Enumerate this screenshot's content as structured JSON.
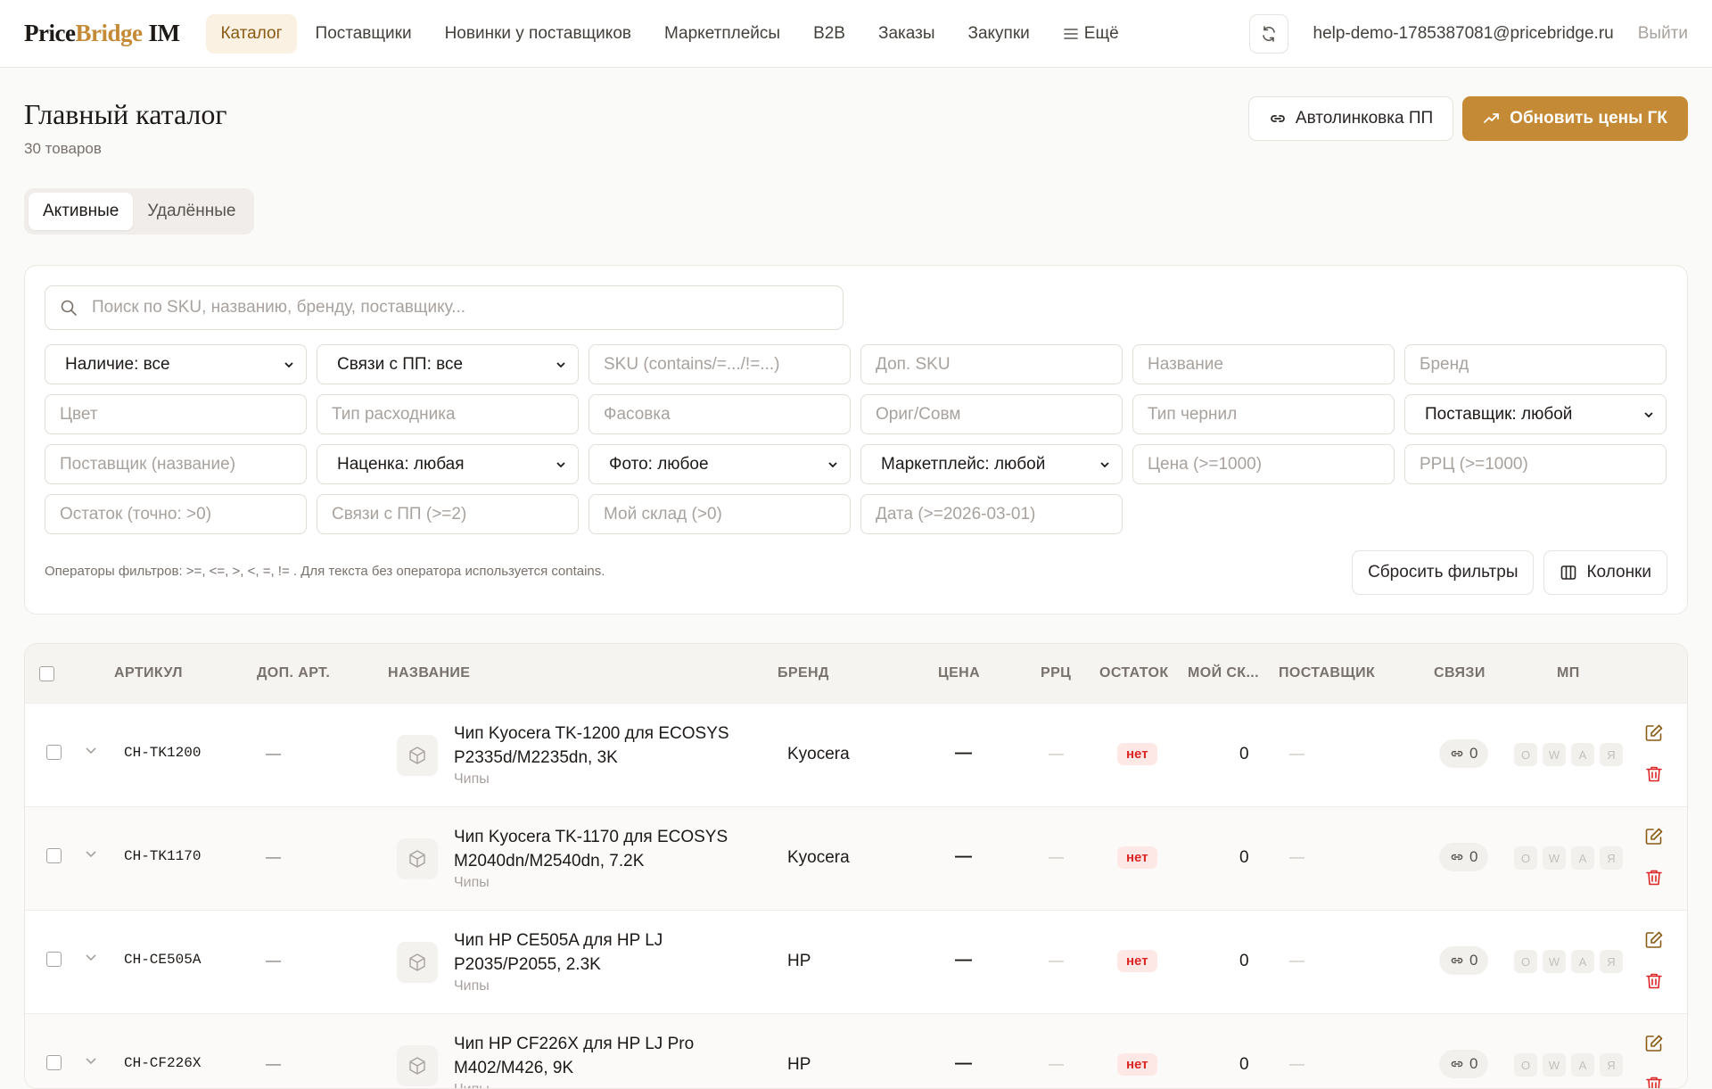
{
  "app": {
    "logo_price": "Price",
    "logo_bridge": "Bridge",
    "logo_im": "IM"
  },
  "nav": {
    "items": [
      {
        "label": "Каталог",
        "active": true
      },
      {
        "label": "Поставщики"
      },
      {
        "label": "Новинки у поставщиков"
      },
      {
        "label": "Маркетплейсы"
      },
      {
        "label": "B2B"
      },
      {
        "label": "Заказы"
      },
      {
        "label": "Закупки"
      }
    ],
    "more_label": "Ещё",
    "user_email": "help-demo-1785387081@pricebridge.ru",
    "logout_label": "Выйти"
  },
  "header": {
    "title": "Главный каталог",
    "subtitle": "30 товаров",
    "autolink_label": "Автолинковка ПП",
    "update_prices_label": "Обновить цены ГК"
  },
  "tabs": [
    {
      "label": "Активные",
      "active": true
    },
    {
      "label": "Удалённые"
    }
  ],
  "filters": {
    "search_placeholder": "Поиск по SKU, названию, бренду, поставщику...",
    "availability": "Наличие: все",
    "links": "Связи с ПП: все",
    "sku_placeholder": "SKU (contains/=.../!=...)",
    "extra_sku_placeholder": "Доп. SKU",
    "name_placeholder": "Название",
    "brand_placeholder": "Бренд",
    "color_placeholder": "Цвет",
    "consumable_placeholder": "Тип расходника",
    "pack_placeholder": "Фасовка",
    "orig_placeholder": "Ориг/Совм",
    "ink_placeholder": "Тип чернил",
    "supplier_select": "Поставщик: любой",
    "supplier_name_placeholder": "Поставщик (название)",
    "markup_select": "Наценка: любая",
    "photo_select": "Фото: любое",
    "marketplace_select": "Маркетплейс: любой",
    "price_placeholder": "Цена (>=1000)",
    "rrp_placeholder": "РРЦ (>=1000)",
    "stock_placeholder": "Остаток (точно: >0)",
    "links_count_placeholder": "Связи с ПП (>=2)",
    "my_stock_placeholder": "Мой склад (>0)",
    "date_placeholder": "Дата (>=2026-03-01)",
    "note": "Операторы фильтров: >=, <=, >, <, =, != . Для текста без оператора используется contains.",
    "reset_label": "Сбросить фильтры",
    "columns_label": "Колонки"
  },
  "table": {
    "headers": {
      "sku": "АРТИКУЛ",
      "extra_sku": "ДОП. АРТ.",
      "name": "НАЗВАНИЕ",
      "brand": "БРЕНД",
      "price": "ЦЕНА",
      "rrp": "РРЦ",
      "stock": "ОСТАТОК",
      "my_stock": "МОЙ СК...",
      "supplier": "ПОСТАВЩИК",
      "links": "СВЯЗИ",
      "mp": "МП"
    },
    "rows": [
      {
        "sku": "CH-TK1200",
        "extra": "—",
        "name": "Чип Kyocera TK-1200 для ECOSYS P2335d/M2235dn, 3K",
        "category": "Чипы",
        "brand": "Kyocera",
        "price": "—",
        "rrp": "—",
        "stock": "нет",
        "my_stock": "0",
        "supplier": "—",
        "links": "0"
      },
      {
        "sku": "CH-TK1170",
        "extra": "—",
        "name": "Чип Kyocera TK-1170 для ECOSYS M2040dn/M2540dn, 7.2K",
        "category": "Чипы",
        "brand": "Kyocera",
        "price": "—",
        "rrp": "—",
        "stock": "нет",
        "my_stock": "0",
        "supplier": "—",
        "links": "0"
      },
      {
        "sku": "CH-CE505A",
        "extra": "—",
        "name": "Чип HP CE505A для HP LJ P2035/P2055, 2.3K",
        "category": "Чипы",
        "brand": "HP",
        "price": "—",
        "rrp": "—",
        "stock": "нет",
        "my_stock": "0",
        "supplier": "—",
        "links": "0"
      },
      {
        "sku": "CH-CF226X",
        "extra": "—",
        "name": "Чип HP CF226X для HP LJ Pro M402/M426, 9K",
        "category": "Чипы",
        "brand": "HP",
        "price": "—",
        "rrp": "—",
        "stock": "нет",
        "my_stock": "0",
        "supplier": "—",
        "links": "0"
      }
    ],
    "mp_badges": [
      "O",
      "W",
      "A",
      "Я"
    ]
  }
}
